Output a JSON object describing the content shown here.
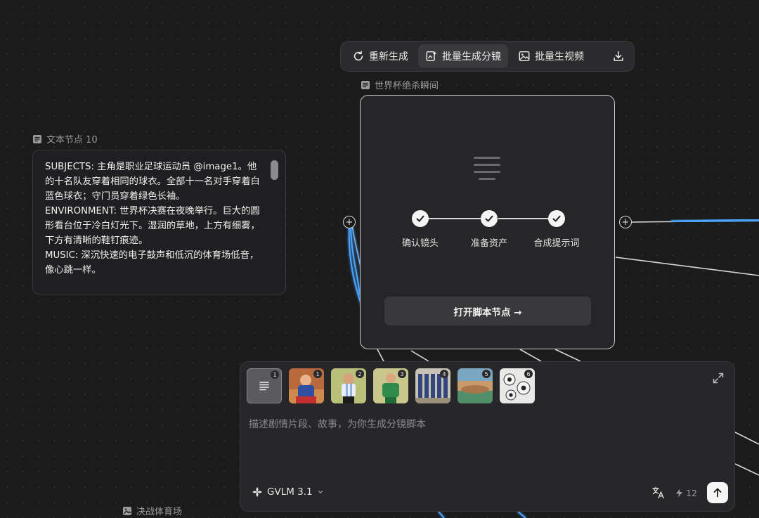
{
  "toolbar": {
    "regenerate_label": "重新生成",
    "batch_storyboard_label": "批量生成分镜",
    "batch_video_label": "批量生视频"
  },
  "text_node": {
    "title": "文本节点 10",
    "content": "SUBJECTS: 主角是职业足球运动员 @image1。他的十名队友穿着相同的球衣。全部十一名对手穿着白蓝色球衣；守门员穿着绿色长袖。\nENVIRONMENT: 世界杯决赛在夜晚举行。巨大的圆形看台位于冷白灯光下。湿润的草地，上方有细雾，下方有清晰的鞋钉痕迹。\nMUSIC: 深沉快速的电子鼓声和低沉的体育场低音，像心跳一样。"
  },
  "script_node": {
    "title": "世界杯绝杀瞬间",
    "steps": [
      "确认镜头",
      "准备资产",
      "合成提示词"
    ],
    "open_button_label": "打开脚本节点 →"
  },
  "image_node": {
    "title": "决战体育场"
  },
  "composer": {
    "thumbnails": [
      {
        "badge": "1",
        "kind": "document"
      },
      {
        "badge": "1",
        "kind": "image"
      },
      {
        "badge": "2",
        "kind": "image"
      },
      {
        "badge": "3",
        "kind": "image"
      },
      {
        "badge": "4",
        "kind": "image"
      },
      {
        "badge": "5",
        "kind": "image"
      },
      {
        "badge": "6",
        "kind": "image"
      }
    ],
    "placeholder": "描述剧情片段、故事，为你生成分镜脚本",
    "model": "GVLM 3.1",
    "credits": "12"
  },
  "colors": {
    "accent_wire": "#4aa3ff",
    "node_border": "#c9c9cb",
    "background": "#1b1b1c"
  }
}
